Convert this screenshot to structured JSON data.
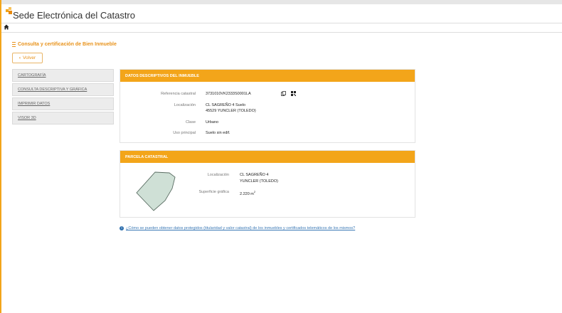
{
  "header": {
    "title": "Sede Electrónica del Catastro"
  },
  "page": {
    "section_title": "Consulta y certificación de Bien Inmueble",
    "back_label": "Volver"
  },
  "sidebar": {
    "items": [
      {
        "label": "CARTOGRAFÍA"
      },
      {
        "label": "CONSULTA DESCRIPTIVA Y GRÁFICA"
      },
      {
        "label": "IMPRIMIR DATOS"
      },
      {
        "label": "VISOR 3D"
      }
    ]
  },
  "descriptive": {
    "title": "DATOS DESCRIPTIVOS DEL INMUEBLE",
    "ref_label": "Referencia catastral",
    "ref_value": "3731010VK2333S0001LA",
    "loc_label": "Localización",
    "loc_line1": "CL SAGREÑO 4 Suelo",
    "loc_line2": "45529 YUNCLER (TOLEDO)",
    "class_label": "Clase",
    "class_value": "Urbano",
    "use_label": "Uso principal",
    "use_value": "Suelo sin edif."
  },
  "parcel": {
    "title": "PARCELA CATASTRAL",
    "loc_label": "Localización",
    "loc_line1": "CL SAGREÑO 4",
    "loc_line2": "YUNCLER (TOLEDO)",
    "surface_label": "Superficie gráfica",
    "surface_value": "2.220 m",
    "surface_unit_sup": "2"
  },
  "help": {
    "text": "¿Cómo se pueden obtener datos protegidos (titularidad y valor catastral) de los inmuebles y certificados telemáticos de los mismos?"
  },
  "colors": {
    "accent": "#f3a51a",
    "link": "#3a78b5",
    "parcel_fill": "#cfe0d6"
  },
  "icons": {
    "logo": "catastro-logo-icon",
    "home": "home-icon",
    "back": "chevron-left-icon",
    "copy": "copy-icon",
    "qr": "qr-code-icon",
    "info": "info-icon"
  }
}
